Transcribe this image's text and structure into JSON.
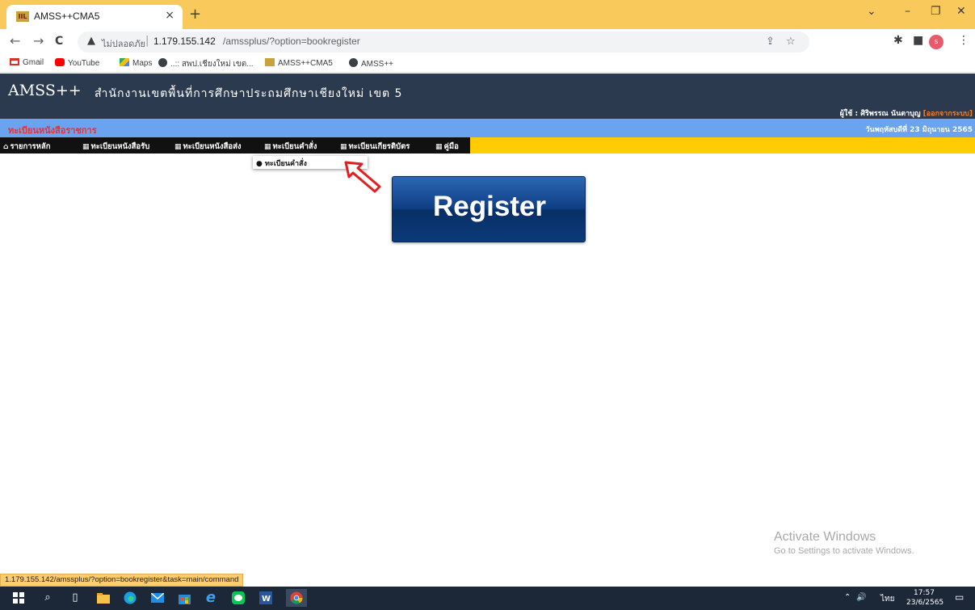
{
  "browser": {
    "tab": {
      "favicon_text": "IIL",
      "title": "AMSS++CMA5",
      "close": "×"
    },
    "new_tab": "+",
    "window_controls": {
      "chevron": "⌄",
      "minimize": "–",
      "restore": "❐",
      "close": "✕"
    },
    "nav": {
      "back": "←",
      "forward": "→",
      "reload": "C"
    },
    "address": {
      "warning_icon": "▲",
      "security_label": "ไม่ปลอดภัย",
      "separator": "|",
      "host": "1.179.155.142",
      "path": "/amssplus/?option=bookregister"
    },
    "toolbar_icons": {
      "share": "⇪",
      "star": "☆",
      "extensions": "✱",
      "sidepanel": "■",
      "profile": "s",
      "menu": "⋮"
    },
    "bookmarks": [
      {
        "label": "Gmail",
        "icon": "gmail-icon"
      },
      {
        "label": "YouTube",
        "icon": "youtube-icon"
      },
      {
        "label": "Maps",
        "icon": "maps-icon"
      },
      {
        "label": "..:: สพป.เชียงใหม่ เขต...",
        "icon": "globe-icon"
      },
      {
        "label": "AMSS++CMA5",
        "icon": "amss-icon"
      },
      {
        "label": "AMSS++",
        "icon": "globe-icon"
      }
    ]
  },
  "site": {
    "logo": "AMSS++",
    "org_name": "สำนักงานเขตพื้นที่การศึกษาประถมศึกษาเชียงใหม่ เขต 5",
    "user_prefix": "ผู้ใช้ : ศิริพรรณ นันตาบุญ ",
    "logout": "[ออกจากระบบ]",
    "registry_title": "ทะเบียนหนังสือราชการ",
    "date": "วันพฤหัสบดีที่ 23 มิถุนายน 2565",
    "menu": [
      {
        "label": "รายการหลัก",
        "icon": "home-icon"
      },
      {
        "label": "ทะเบียนหนังสือรับ",
        "icon": "grid-icon"
      },
      {
        "label": "ทะเบียนหนังสือส่ง",
        "icon": "grid-icon"
      },
      {
        "label": "ทะเบียนคำสั่ง",
        "icon": "grid-icon"
      },
      {
        "label": "ทะเบียนเกียรติบัตร",
        "icon": "grid-icon"
      },
      {
        "label": "คู่มือ",
        "icon": "grid-icon"
      }
    ],
    "dropdown_item": "ทะเบียนคำสั่ง",
    "register_button": "Register"
  },
  "overlay": {
    "activate_title": "Activate Windows",
    "activate_sub": "Go to Settings to activate Windows."
  },
  "status_url": "1.179.155.142/amssplus/?option=bookregister&task=main/command",
  "taskbar": {
    "apps": [
      "windows-start-icon",
      "search-icon",
      "task-view-icon",
      "file-explorer-icon",
      "edge-icon",
      "mail-icon",
      "store-icon",
      "ie-icon",
      "line-icon",
      "word-icon",
      "chrome-icon"
    ],
    "tray_chevron": "⌃",
    "volume": "🔊",
    "language": "ไทย",
    "time": "17:57",
    "date": "23/6/2565",
    "notifications": "▭"
  }
}
